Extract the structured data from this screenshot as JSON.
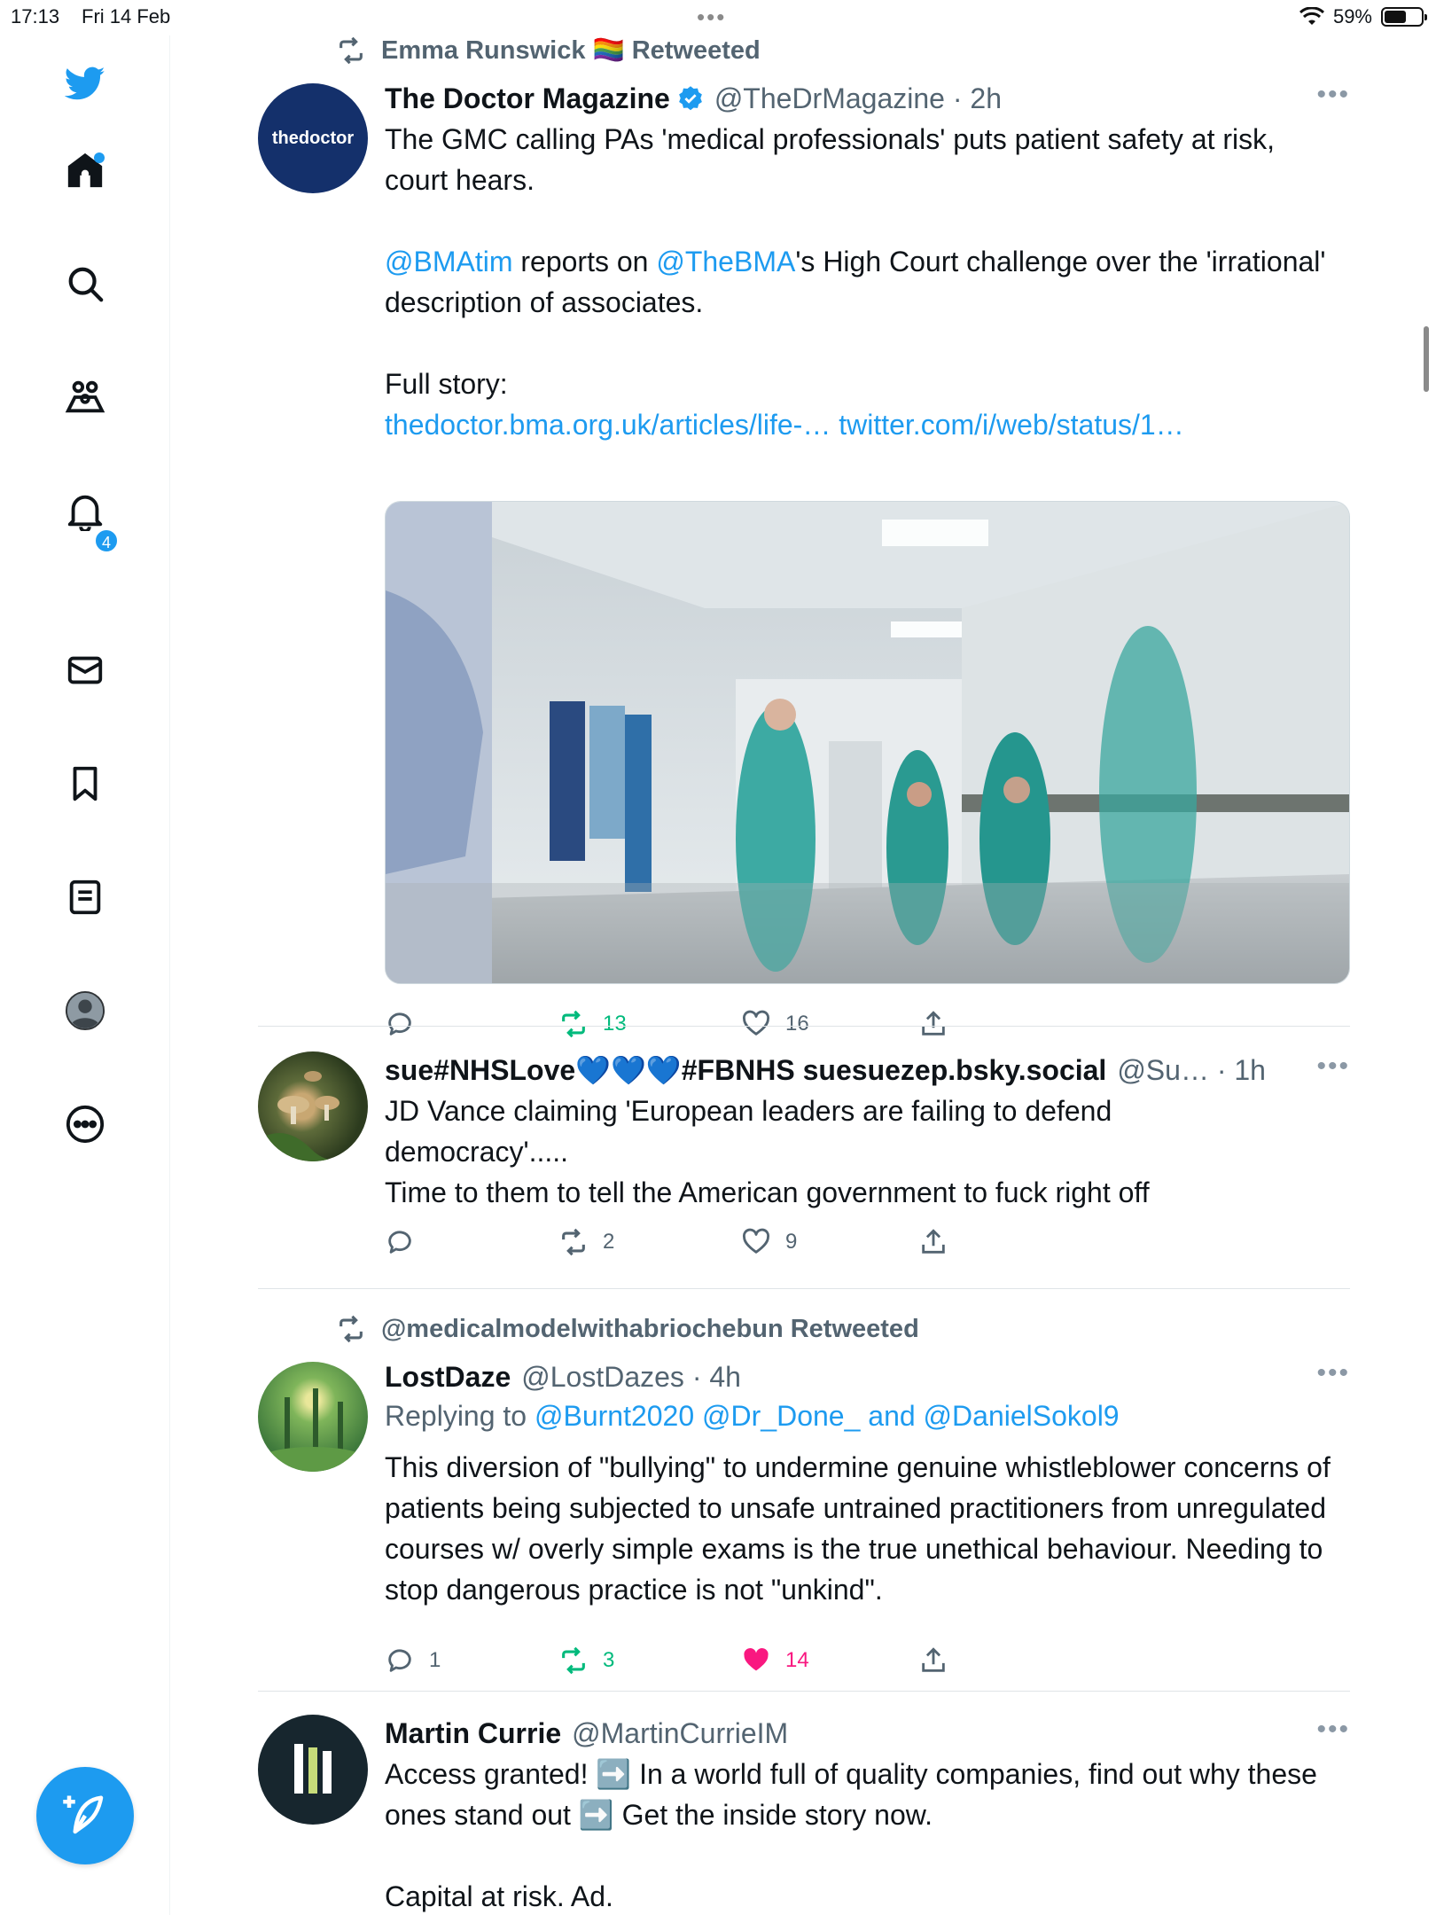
{
  "status_bar": {
    "time": "17:13",
    "date": "Fri 14 Feb",
    "battery": "59%",
    "battery_level": 0.59
  },
  "sidebar": {
    "items": [
      {
        "name": "twitter-logo",
        "label": "Twitter"
      },
      {
        "name": "home",
        "label": "Home"
      },
      {
        "name": "explore",
        "label": "Explore"
      },
      {
        "name": "communities",
        "label": "Communities"
      },
      {
        "name": "notifications",
        "label": "Notifications",
        "badge": "4"
      },
      {
        "name": "messages",
        "label": "Messages"
      },
      {
        "name": "bookmarks",
        "label": "Bookmarks"
      },
      {
        "name": "lists",
        "label": "Lists"
      },
      {
        "name": "profile",
        "label": "Profile"
      },
      {
        "name": "more",
        "label": "More"
      }
    ],
    "compose_label": "Tweet"
  },
  "tweets": [
    {
      "retweeted_by": "Emma Runswick 🏳️‍🌈 Retweeted",
      "avatar_text": "thedoctor",
      "name": "The Doctor Magazine",
      "verified": true,
      "handle": "@TheDrMagazine · 2h",
      "text1": "The GMC calling PAs 'medical professionals' puts patient safety at risk, court hears.",
      "mention1": "@BMAtim",
      "text2": " reports on ",
      "mention2": "@TheBMA",
      "text3": "'s High Court challenge over the 'irrational' description of associates.",
      "text4": "Full story:",
      "link1": "thedoctor.bma.org.uk/articles/life-…",
      "link2": "twitter.com/i/web/status/1…",
      "replies": "",
      "retweets": "13",
      "likes": "16"
    },
    {
      "name": "sue#NHSLove💙💙💙#FBNHS suesuezep.bsky.social",
      "handle": "@Su… · 1h",
      "text": "JD Vance claiming 'European leaders are failing to defend democracy'.....\nTime to them to tell the American government to fuck right off",
      "replies": "",
      "retweets": "2",
      "likes": "9"
    },
    {
      "retweeted_by": "@medicalmodelwithabriochebun Retweeted",
      "name": "LostDaze",
      "handle": "@LostDazes · 4h",
      "replying_prefix": "Replying to ",
      "replying_to": "@Burnt2020 @Dr_Done_ and @DanielSokol9",
      "text": "This diversion of \"bullying\" to undermine genuine whistleblower concerns of patients being subjected to unsafe untrained practitioners from unregulated courses w/ overly simple exams is the true unethical behaviour. Needing to stop dangerous practice is not \"unkind\".",
      "replies": "1",
      "retweets": "3",
      "likes": "14"
    },
    {
      "name": "Martin Currie",
      "handle": "@MartinCurrieIM",
      "text": "Access granted! ➡️ In a world full of quality companies, find out why these ones stand out ➡️ Get the inside story now.",
      "text2": "Capital at risk. Ad."
    }
  ],
  "colors": {
    "accent": "#1d9bf0",
    "retweet": "#00ba7c",
    "like": "#f91880",
    "avatar_doctor": "#14306b"
  }
}
